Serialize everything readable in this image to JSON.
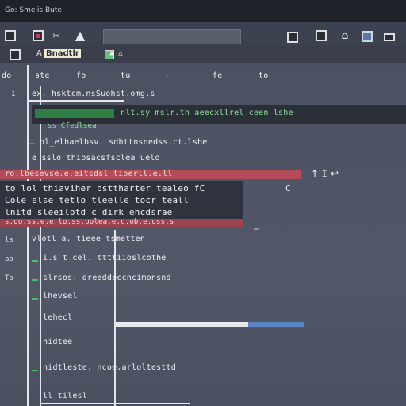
{
  "window": {
    "title": "Go: Smelis Bute"
  },
  "toolbar": {
    "icons": [
      "window-icon",
      "close-box-icon",
      "scissors-icon",
      "warning-icon",
      "save-icon",
      "list-icon",
      "home-icon",
      "monitor-icon",
      "minimize-icon"
    ],
    "scissors_glyph": "✂",
    "warning_glyph": "▲",
    "home_glyph": "⌂"
  },
  "toolbar2": {
    "label_prefix": "A",
    "label": "Bnadtlr",
    "symbols": "▲ △"
  },
  "editor": {
    "top_tokens": [
      "do",
      "ste",
      "fo",
      "tu",
      "·",
      "fe",
      "to"
    ],
    "lines": [
      {
        "no": "1",
        "text": "ex.    hsktcm.nsSuohst.omg.s"
      },
      {
        "no": "",
        "text": "nlt.sy    mslr.th   aeecxllrel   ceen_lshe"
      },
      {
        "no": "",
        "text": "  ss Cfedlsea"
      },
      {
        "no": "",
        "text": "ol_elhaelbsv.  sdhttnsnedss.ct.lshe"
      },
      {
        "no": "",
        "text": "  e  sslo  thiosacsfsclea  uelo"
      },
      {
        "no": "",
        "text": "ro.lbesevse.e.eitsdsl  tioerll.e.ll"
      },
      {
        "no": "",
        "text": "to  lol   thiaviher   bsttharter   tealeo   fC"
      },
      {
        "no": "",
        "text": "Cole  else   tetlo   tleelle   tocr   teall"
      },
      {
        "no": "",
        "text": "lnitd  sleeilotd   c   dirk   ehcdsrae"
      },
      {
        "no": "",
        "text": "s.oo.ss.e.e.lo.ss.bolea.e.c.ob.e.oss.s"
      },
      {
        "no": "",
        "text": "vlotl a.    tieee  tsmetten"
      },
      {
        "no": "",
        "text": "  i.s   t  cel.  ttttiioslcothe"
      },
      {
        "no": "",
        "text": "  slrsos.   dreeddeccncimonsnd"
      },
      {
        "no": "",
        "text": "  lhevsel"
      },
      {
        "no": "",
        "text": "  lehecl"
      },
      {
        "no": "",
        "text": "  nidtee"
      },
      {
        "no": "",
        "text": "  nidtleste.  ncoe.arloltesttd"
      },
      {
        "no": "",
        "text": "  ll   tilesl"
      }
    ],
    "gutter_labels": [
      "ls",
      "ao",
      "To",
      "fo",
      "lo"
    ],
    "side_icons": "↑ ⌶ ↩",
    "side_short": "C",
    "arrow_glyph": "⇐",
    "bottom_number": "3"
  },
  "progress": {
    "value": 0.3
  },
  "colors": {
    "accent_blue": "#5b86c4",
    "highlight_red": "#b34c58",
    "highlight_green": "#2f7f45",
    "background": "#4a4f5e"
  }
}
